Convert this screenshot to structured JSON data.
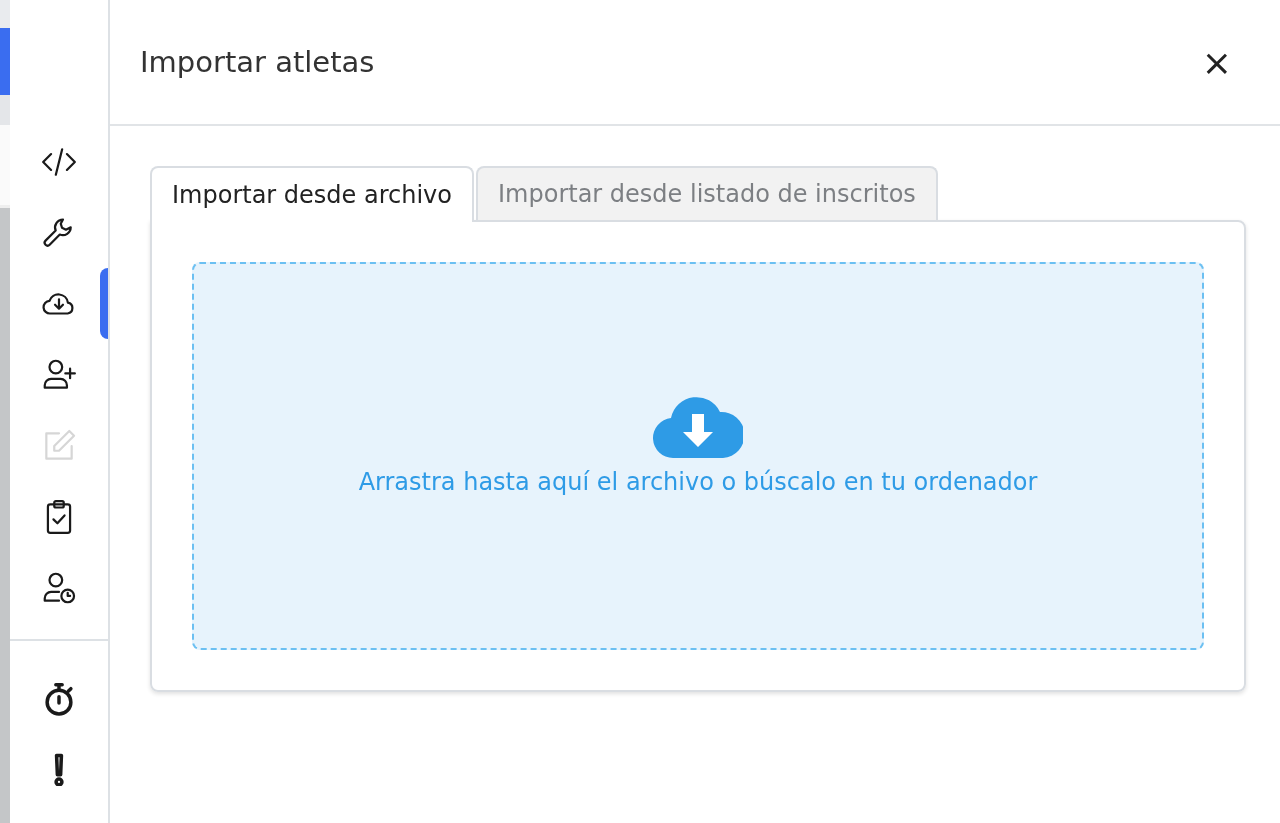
{
  "sidebar": {
    "items": [
      {
        "kind": "code",
        "selected": false,
        "disabled": false
      },
      {
        "kind": "wrench",
        "selected": false,
        "disabled": false
      },
      {
        "kind": "cloud-download",
        "selected": true,
        "disabled": false
      },
      {
        "kind": "user-plus",
        "selected": false,
        "disabled": false
      },
      {
        "kind": "edit",
        "selected": false,
        "disabled": true
      },
      {
        "kind": "clipboard-check",
        "selected": false,
        "disabled": false
      },
      {
        "kind": "user-clock",
        "selected": false,
        "disabled": false
      }
    ],
    "bottom_items": [
      {
        "kind": "stopwatch",
        "selected": false,
        "disabled": false
      },
      {
        "kind": "exclamation",
        "selected": false,
        "disabled": false
      }
    ]
  },
  "dialog": {
    "title": "Importar atletas",
    "close": "×",
    "tabs": [
      {
        "label": "Importar desde archivo",
        "selected": true
      },
      {
        "label": "Importar desde listado de inscritos",
        "selected": false
      }
    ],
    "dropzone": {
      "text": "Arrastra hasta aquí el archivo o búscalo en tu ordenador"
    }
  }
}
